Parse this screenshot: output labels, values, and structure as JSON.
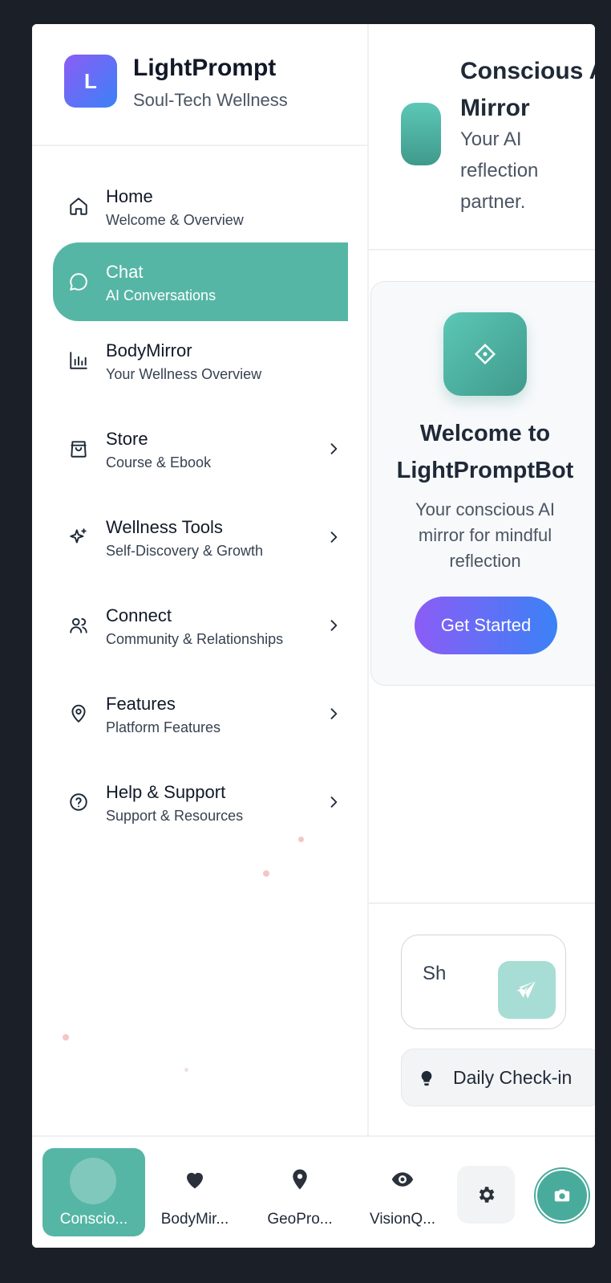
{
  "brand": {
    "logo_letter": "L",
    "name": "LightPrompt",
    "tagline": "Soul-Tech Wellness"
  },
  "nav": [
    {
      "title": "Home",
      "subtitle": "Welcome & Overview",
      "icon": "home-icon",
      "active": false,
      "has_chevron": false
    },
    {
      "title": "Chat",
      "subtitle": "AI Conversations",
      "icon": "chat-bubble-icon",
      "active": true,
      "has_chevron": false
    },
    {
      "title": "BodyMirror",
      "subtitle": "Your Wellness Overview",
      "icon": "bar-chart-icon",
      "active": false,
      "has_chevron": false
    },
    {
      "title": "Store",
      "subtitle": "Course & Ebook",
      "icon": "shopping-bag-icon",
      "active": false,
      "has_chevron": true
    },
    {
      "title": "Wellness Tools",
      "subtitle": "Self-Discovery & Growth",
      "icon": "sparkles-icon",
      "active": false,
      "has_chevron": true
    },
    {
      "title": "Connect",
      "subtitle": "Community & Relationships",
      "icon": "users-icon",
      "active": false,
      "has_chevron": true
    },
    {
      "title": "Features",
      "subtitle": "Platform Features",
      "icon": "map-pin-icon",
      "active": false,
      "has_chevron": true
    },
    {
      "title": "Help & Support",
      "subtitle": "Support & Resources",
      "icon": "help-circle-icon",
      "active": false,
      "has_chevron": true
    }
  ],
  "header": {
    "title": "Conscious AI Mirror",
    "subtitle": "Your AI reflection partner."
  },
  "welcome": {
    "title": "Welcome to LightPromptBot",
    "text": "Your conscious AI mirror for mindful reflection",
    "cta_label": "Get Started",
    "icon": "diamond-icon"
  },
  "composer": {
    "input_value": "Sh",
    "send_icon": "send-icon"
  },
  "checkin": {
    "label": "Daily Check-in",
    "icon": "lightbulb-icon"
  },
  "bottom_tabs": [
    {
      "label": "Conscio...",
      "icon": "avatar",
      "active": true
    },
    {
      "label": "BodyMir...",
      "icon": "heart-icon",
      "active": false
    },
    {
      "label": "GeoPro...",
      "icon": "map-marker-icon",
      "active": false
    },
    {
      "label": "VisionQ...",
      "icon": "eye-icon",
      "active": false
    }
  ],
  "bottom_actions": {
    "settings_icon": "gear-icon",
    "camera_icon": "camera-icon"
  },
  "colors": {
    "accent": "#56b6a5",
    "brand_gradient_start": "#8b5cf6",
    "brand_gradient_end": "#3b82f6",
    "background": "#1b1f27"
  }
}
